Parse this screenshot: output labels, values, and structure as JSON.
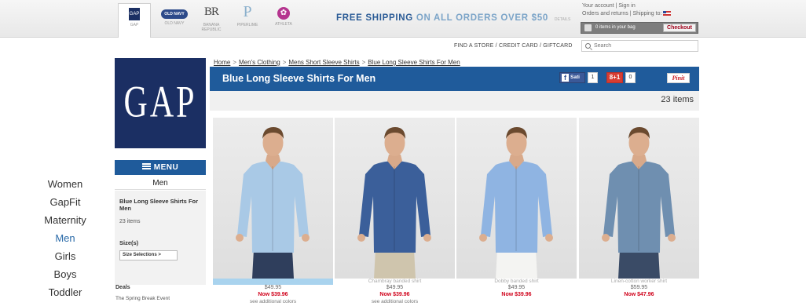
{
  "brands": [
    {
      "logo": "GAP",
      "name": "GAP"
    },
    {
      "logo": "OLD NAVY",
      "name": "OLD NAVY"
    },
    {
      "logo": "BR",
      "name": "BANANA REPUBLIC"
    },
    {
      "logo": "P",
      "name": "PIPERLIME"
    },
    {
      "logo": "✿",
      "name": "ATHLETA"
    }
  ],
  "promo": {
    "free": "FREE SHIPPING",
    "on_all": "ON ALL ORDERS OVER $50",
    "details": "DETAILS"
  },
  "account": {
    "line1": "Your account | Sign in",
    "line2": "Orders and returns | Shipping to:",
    "bag": "0 items in your bag",
    "checkout": "Checkout"
  },
  "utility": {
    "links": "FIND A STORE / CREDIT CARD / GIFTCARD",
    "search_placeholder": "Search"
  },
  "logo": "GAP",
  "menu": {
    "label": "MENU",
    "category": "Men",
    "refine_title": "Blue Long Sleeve Shirts For Men",
    "refine_count": "23 items",
    "size_label": "Size(s)",
    "size_button": "Size Selections >",
    "deals_title": "Deals",
    "deals_item": "The Spring Break Event"
  },
  "departments": [
    "Women",
    "GapFit",
    "Maternity",
    "Men",
    "Girls",
    "Boys",
    "Toddler"
  ],
  "breadcrumb": [
    "Home",
    "Men's Clothing",
    "Mens Short Sleeve Shirts",
    "Blue Long Sleeve Shirts For Men"
  ],
  "page": {
    "title": "Blue Long Sleeve Shirts For Men",
    "item_count": "23 items"
  },
  "social": {
    "facebook_label": "Sati",
    "facebook_count": "1",
    "gplus_label": "8+1",
    "gplus_count": "0",
    "pinterest_label": "Pinit"
  },
  "products": [
    {
      "name": "Chambray banded shirt",
      "price": "$49.95",
      "sale": "Now $39.96",
      "more": "see additional colors",
      "shirt": "#a9c9e6",
      "pants": "#2f3e5c"
    },
    {
      "name": "Chambray banded shirt",
      "price": "$49.95",
      "sale": "Now $39.96",
      "more": "see additional colors",
      "shirt": "#3b5f9a",
      "pants": "#cfc5ad"
    },
    {
      "name": "Dobby banded shirt",
      "price": "$49.95",
      "sale": "Now $39.96",
      "more": "",
      "shirt": "#8fb4e2",
      "pants": "#f4f4f2"
    },
    {
      "name": "Linen-cotton worker shirt",
      "price": "$59.95",
      "sale": "Now $47.96",
      "more": "",
      "shirt": "#6f8fb0",
      "pants": "#3a4b66"
    }
  ],
  "colors": {
    "navy": "#1b2f63",
    "title_bar": "#1f5b9b",
    "sale_red": "#d0021b"
  }
}
